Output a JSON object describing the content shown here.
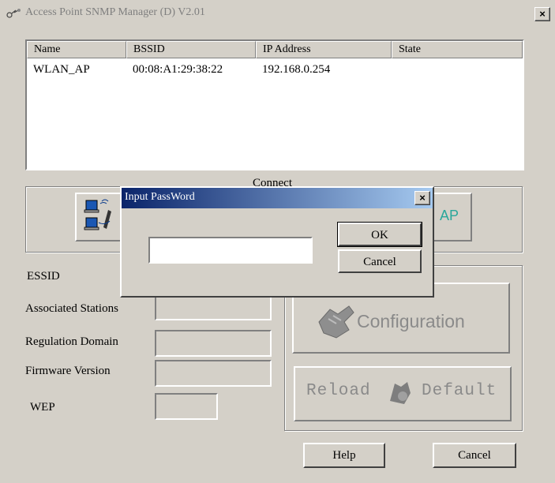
{
  "window": {
    "title": "Access Point SNMP Manager (D) V2.01",
    "close_glyph": "×"
  },
  "list": {
    "columns": [
      "Name",
      "BSSID",
      "IP Address",
      "State"
    ],
    "rows": [
      {
        "name": "WLAN_AP",
        "bssid": "00:08:A1:29:38:22",
        "ip": "192.168.0.254",
        "state": ""
      }
    ]
  },
  "connect_group": {
    "label": "Connect",
    "right_button_label": "AP"
  },
  "info": {
    "essid_label": "ESSID",
    "associated_label": "Associated Stations",
    "regulation_label": "Regulation Domain",
    "firmware_label": "Firmware Version",
    "wep_label": "WEP"
  },
  "actions": {
    "configuration_label": "Configuration",
    "reload_label": "Reload",
    "default_label": "Default"
  },
  "footer": {
    "help_label": "Help",
    "cancel_label": "Cancel"
  },
  "dialog": {
    "title": "Input PassWord",
    "password_value": "",
    "ok_label": "OK",
    "cancel_label": "Cancel"
  },
  "colors": {
    "face": "#d4d0c8",
    "dialog_title_start": "#0a246a",
    "dialog_title_end": "#a6caf0",
    "disabled_text": "#8a8a8a",
    "ap_text": "#2aa79b"
  },
  "icons": [
    "app-icon",
    "close-icon",
    "network-computers-icon",
    "configuration-hand-icon",
    "reload-default-icon"
  ]
}
